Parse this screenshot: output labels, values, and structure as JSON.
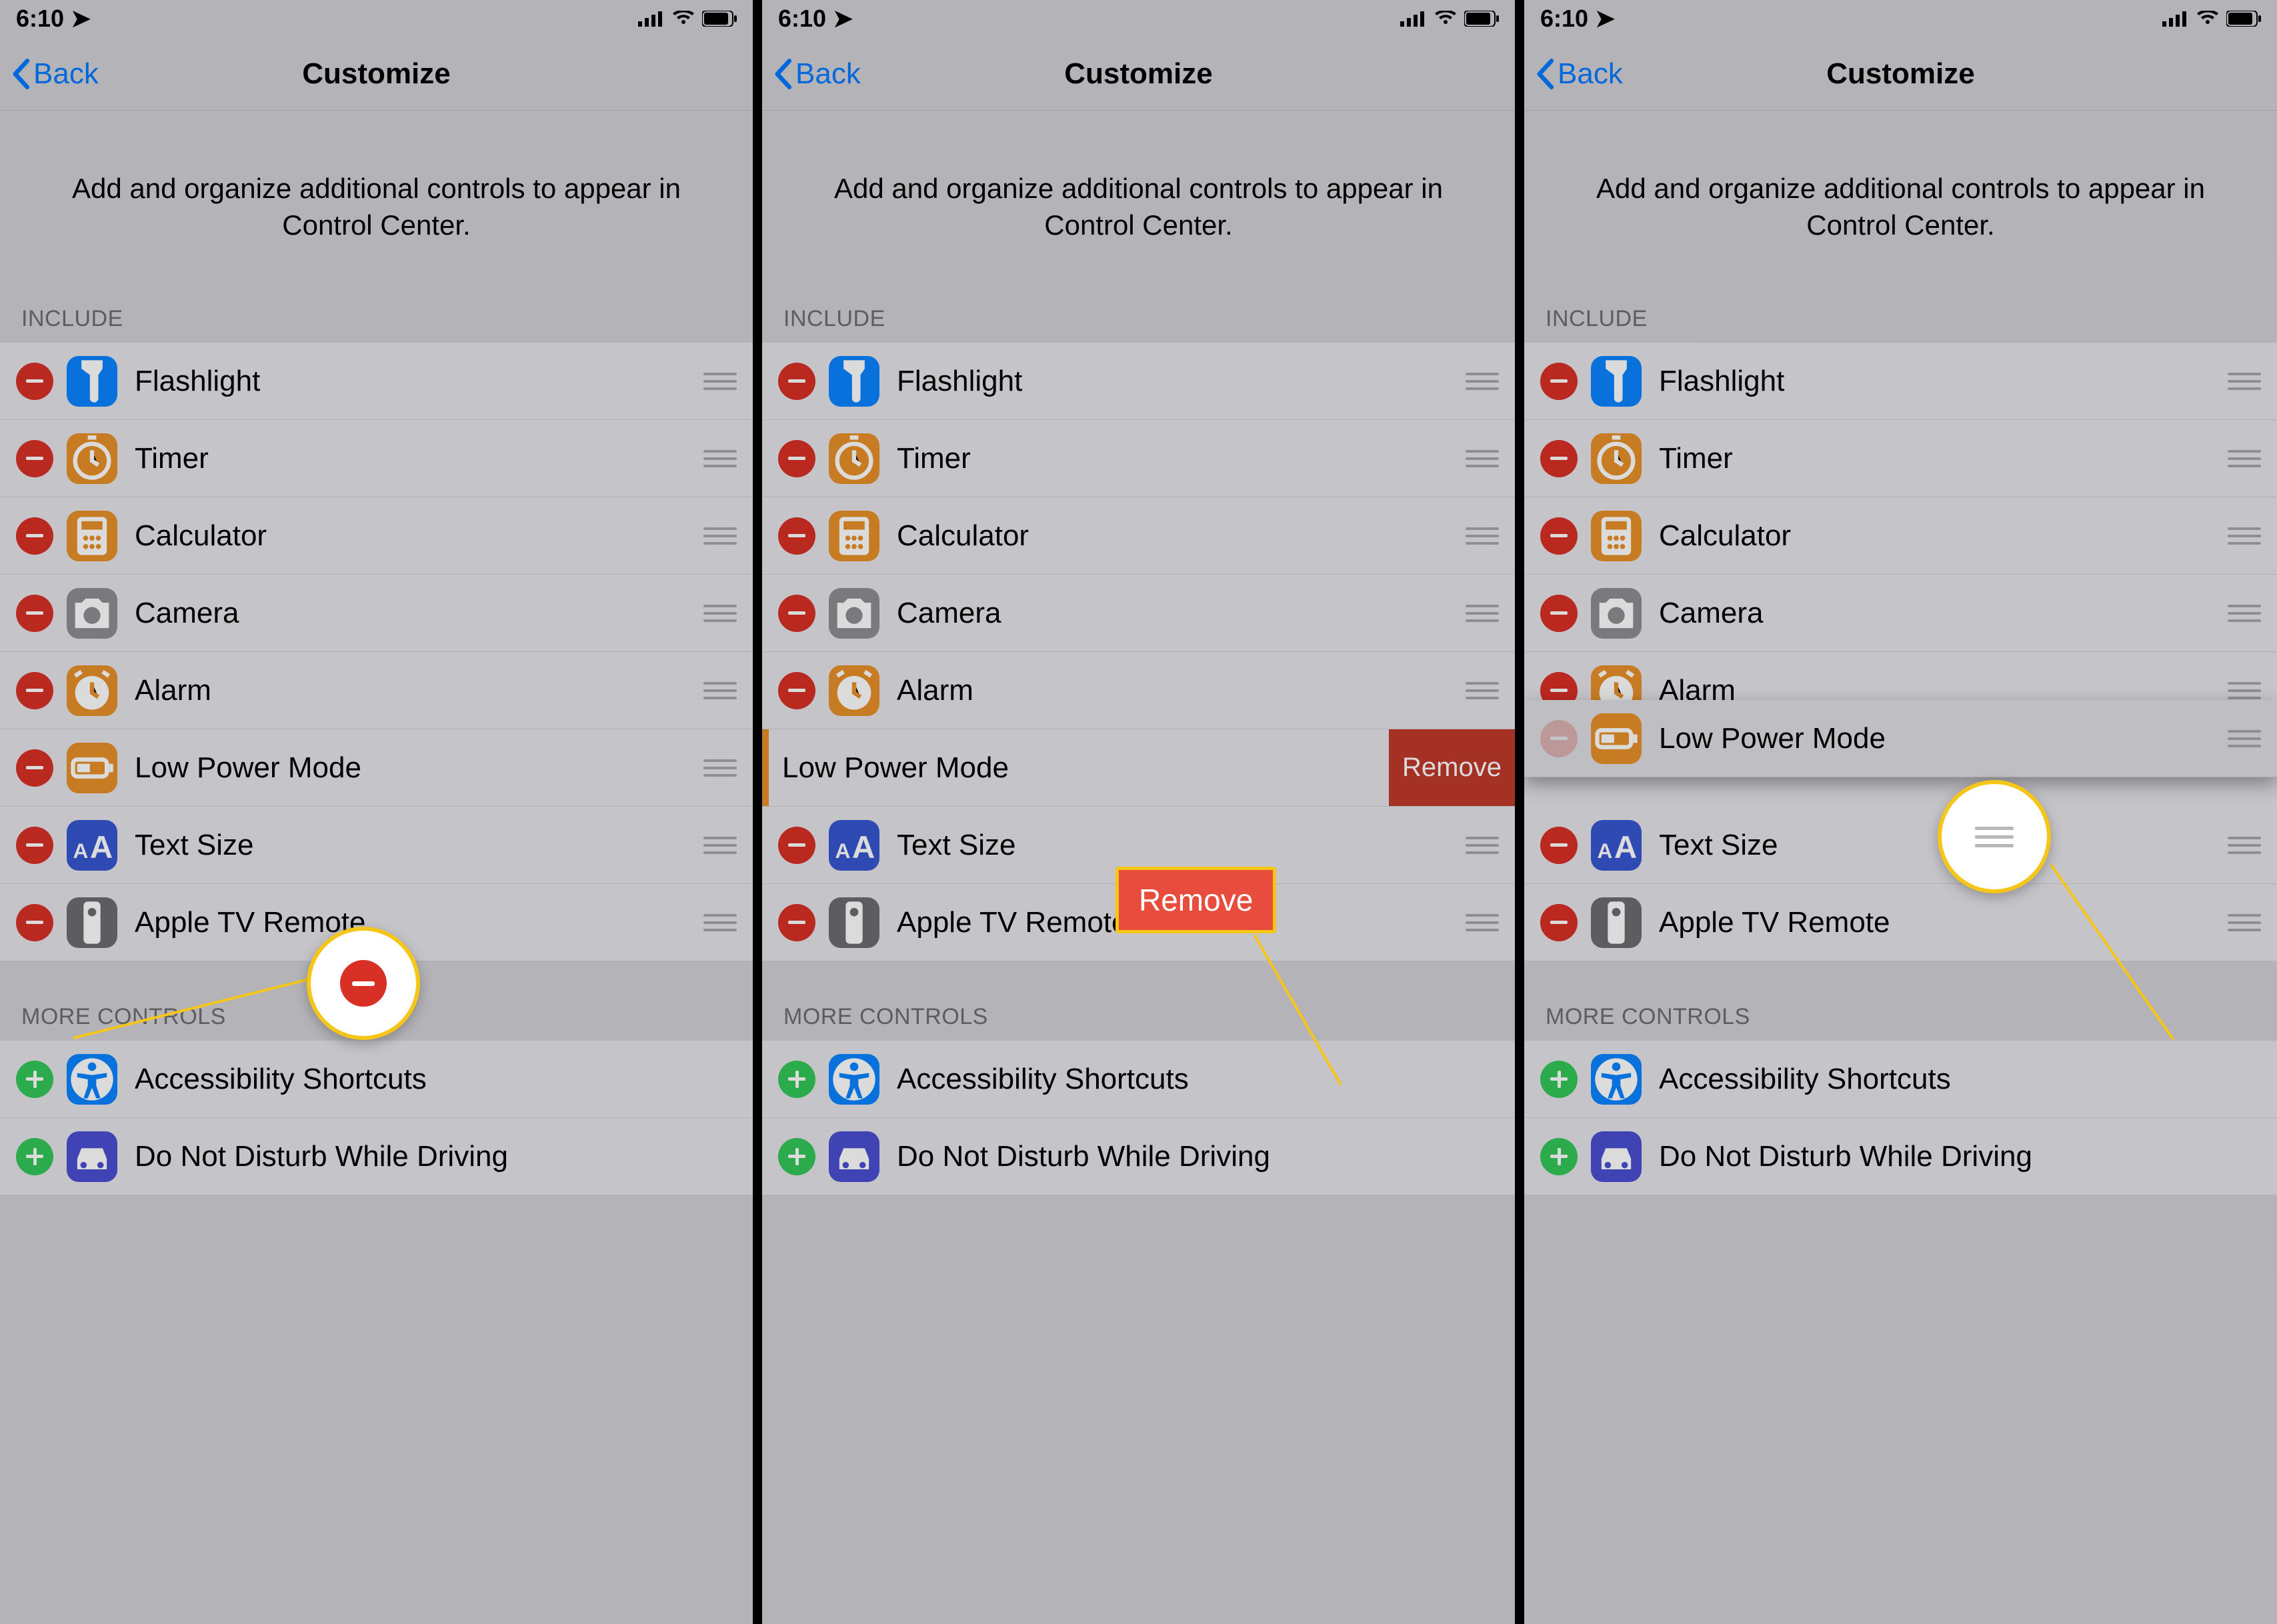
{
  "status": {
    "time": "6:10",
    "location_arrow": true
  },
  "nav": {
    "back": "Back",
    "title": "Customize"
  },
  "description": "Add and organize additional controls to appear in Control Center.",
  "sections": {
    "include": "INCLUDE",
    "more": "MORE CONTROLS"
  },
  "include": [
    {
      "id": "flashlight",
      "label": "Flashlight",
      "icon": "flashlight-icon",
      "bg": "ic-blue"
    },
    {
      "id": "timer",
      "label": "Timer",
      "icon": "timer-icon",
      "bg": "ic-orange"
    },
    {
      "id": "calculator",
      "label": "Calculator",
      "icon": "calculator-icon",
      "bg": "ic-orange"
    },
    {
      "id": "camera",
      "label": "Camera",
      "icon": "camera-icon",
      "bg": "ic-gray"
    },
    {
      "id": "alarm",
      "label": "Alarm",
      "icon": "alarm-icon",
      "bg": "ic-orange"
    },
    {
      "id": "lowpower",
      "label": "Low Power Mode",
      "icon": "battery-icon",
      "bg": "ic-orange"
    },
    {
      "id": "textsize",
      "label": "Text Size",
      "icon": "textsize-icon",
      "bg": "ic-deepblue"
    },
    {
      "id": "appletv",
      "label": "Apple TV Remote",
      "icon": "remote-icon",
      "bg": "ic-darkgray"
    }
  ],
  "more": [
    {
      "id": "accessibility",
      "label": "Accessibility Shortcuts",
      "icon": "accessibility-icon",
      "bg": "ic-blue"
    },
    {
      "id": "dnd",
      "label": "Do Not Disturb While Driving",
      "icon": "car-icon",
      "bg": "ic-purple"
    }
  ],
  "remove_label": "Remove",
  "callouts": {
    "panel1_minus": true,
    "panel2_remove": true,
    "panel3_grip": true
  }
}
